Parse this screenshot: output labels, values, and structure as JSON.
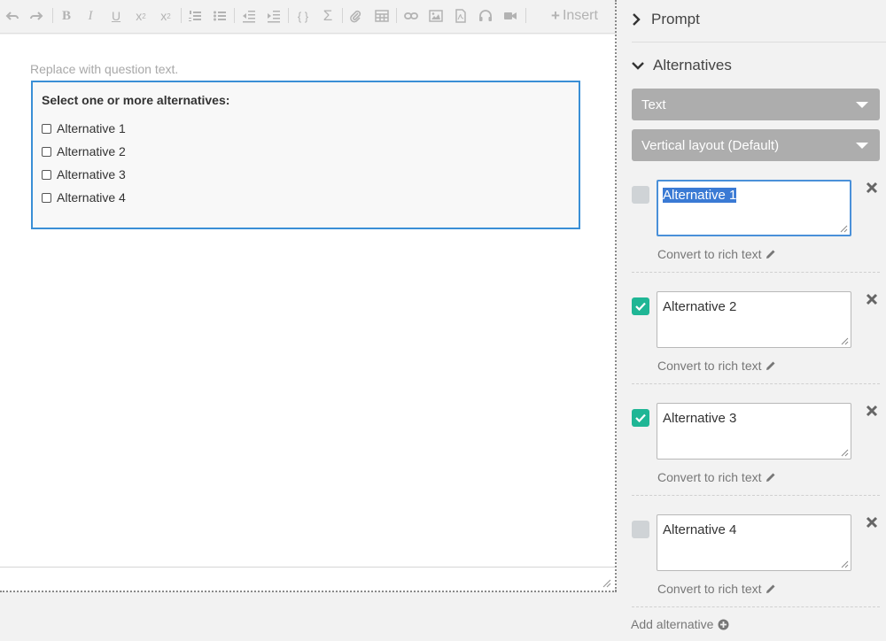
{
  "editor": {
    "insert_label": "Insert",
    "question_placeholder": "Replace with question text.",
    "choice_prompt": "Select one or more alternatives:",
    "choices": [
      "Alternative 1",
      "Alternative 2",
      "Alternative 3",
      "Alternative 4"
    ],
    "toolbar_icons": [
      "undo-icon",
      "redo-icon",
      "bold-icon",
      "italic-icon",
      "underline-icon",
      "subscript-icon",
      "superscript-icon",
      "ordered-list-icon",
      "unordered-list-icon",
      "outdent-icon",
      "indent-icon",
      "code-braces-icon",
      "sigma-icon",
      "attachment-icon",
      "table-icon",
      "link-icon",
      "image-icon",
      "pdf-icon",
      "audio-icon",
      "video-icon"
    ]
  },
  "panel": {
    "prompt_label": "Prompt",
    "alternatives_label": "Alternatives",
    "type_select": "Text",
    "layout_select": "Vertical layout (Default)",
    "alternatives": [
      {
        "text": "Alternative 1",
        "correct": false,
        "focused": true
      },
      {
        "text": "Alternative 2",
        "correct": true,
        "focused": false
      },
      {
        "text": "Alternative 3",
        "correct": true,
        "focused": false
      },
      {
        "text": "Alternative 4",
        "correct": false,
        "focused": false
      }
    ],
    "convert_label": "Convert to rich text",
    "add_alternative_label": "Add alternative"
  },
  "colors": {
    "accent_blue": "#3a8fd6",
    "correct_green": "#1fb695",
    "dropdown_gray": "#adadad",
    "unchecked_gray": "#cfd3d6"
  }
}
